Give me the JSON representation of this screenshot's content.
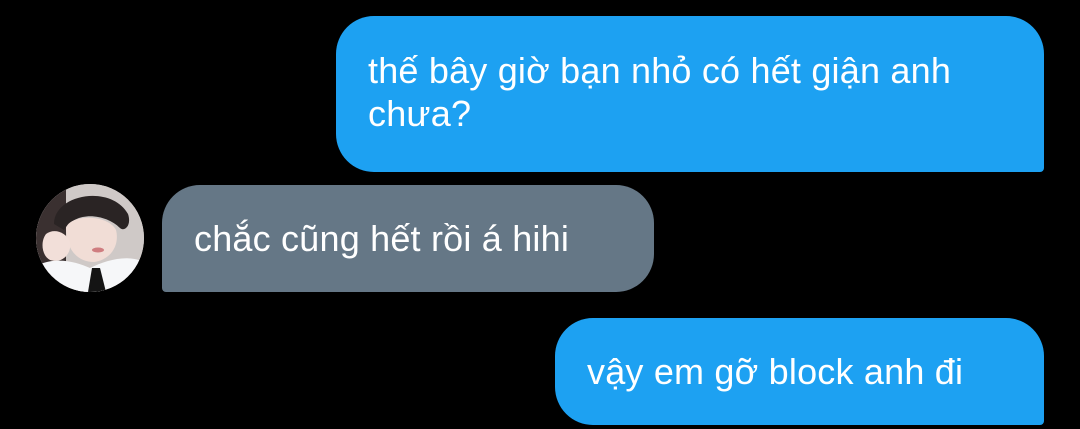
{
  "conversation": {
    "messages": [
      {
        "direction": "outgoing",
        "text": "thế bây giờ bạn nhỏ có hết giận anh chưa?"
      },
      {
        "direction": "incoming",
        "text": "chắc cũng hết rồi á hihi"
      },
      {
        "direction": "outgoing",
        "text": "vậy em gỡ block anh đi"
      }
    ]
  },
  "colors": {
    "background": "#000000",
    "outgoing_bubble": "#1da1f2",
    "incoming_bubble": "#657786",
    "text": "#ffffff"
  },
  "icons": {
    "avatar": "avatar-photo"
  }
}
